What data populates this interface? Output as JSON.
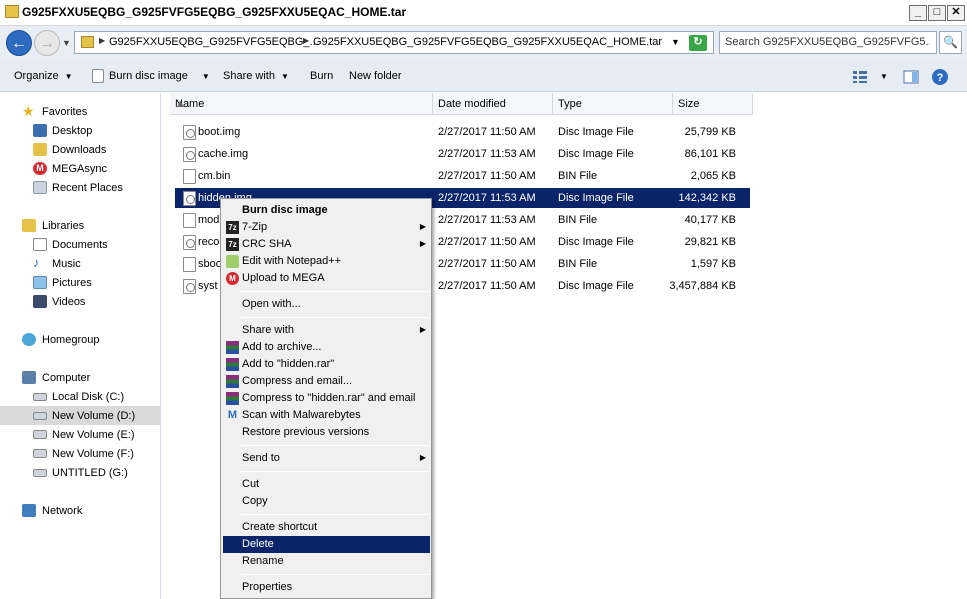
{
  "window": {
    "title": "G925FXXU5EQBG_G925FVFG5EQBG_G925FXXU5EQAC_HOME.tar",
    "min_label": "_",
    "max_label": "□",
    "close_label": "✕"
  },
  "address": {
    "crumb1": "G925FXXU5EQBG_G925FVFG5EQBG_...",
    "crumb2": "G925FXXU5EQBG_G925FVFG5EQBG_G925FXXU5EQAC_HOME.tar",
    "search_placeholder": "Search G925FXXU5EQBG_G925FVFG5..."
  },
  "toolbar": {
    "organize": "Organize",
    "burn_disc_image": "Burn disc image",
    "share_with": "Share with",
    "burn": "Burn",
    "new_folder": "New folder"
  },
  "sidebar": {
    "favorites": "Favorites",
    "desktop": "Desktop",
    "downloads": "Downloads",
    "megasync": "MEGAsync",
    "recent_places": "Recent Places",
    "libraries": "Libraries",
    "documents": "Documents",
    "music": "Music",
    "pictures": "Pictures",
    "videos": "Videos",
    "homegroup": "Homegroup",
    "computer": "Computer",
    "local_disk_c": "Local Disk (C:)",
    "new_volume_d": "New Volume (D:)",
    "new_volume_e": "New Volume (E:)",
    "new_volume_f": "New Volume (F:)",
    "untitled_g": "UNTITLED (G:)",
    "network": "Network"
  },
  "columns": {
    "name": "Name",
    "date_modified": "Date modified",
    "type": "Type",
    "size": "Size"
  },
  "files": [
    {
      "name": "boot.img",
      "date": "2/27/2017 11:50 AM",
      "type": "Disc Image File",
      "size": "25,799 KB"
    },
    {
      "name": "cache.img",
      "date": "2/27/2017 11:53 AM",
      "type": "Disc Image File",
      "size": "86,101 KB"
    },
    {
      "name": "cm.bin",
      "date": "2/27/2017 11:50 AM",
      "type": "BIN File",
      "size": "2,065 KB"
    },
    {
      "name": "hidden.img",
      "date": "2/27/2017 11:53 AM",
      "type": "Disc Image File",
      "size": "142,342 KB"
    },
    {
      "name": "mod",
      "date": "2/27/2017 11:53 AM",
      "type": "BIN File",
      "size": "40,177 KB"
    },
    {
      "name": "reco",
      "date": "2/27/2017 11:50 AM",
      "type": "Disc Image File",
      "size": "29,821 KB"
    },
    {
      "name": "sboo",
      "date": "2/27/2017 11:50 AM",
      "type": "BIN File",
      "size": "1,597 KB"
    },
    {
      "name": "syst",
      "date": "2/27/2017 11:50 AM",
      "type": "Disc Image File",
      "size": "3,457,884 KB"
    }
  ],
  "context_menu": {
    "burn_disc_image": "Burn disc image",
    "seven_zip": "7-Zip",
    "crc_sha": "CRC SHA",
    "edit_notepad": "Edit with Notepad++",
    "upload_mega": "Upload to MEGA",
    "open_with": "Open with...",
    "share_with": "Share with",
    "add_to_archive": "Add to archive...",
    "add_to_rar": "Add to \"hidden.rar\"",
    "compress_email": "Compress and email...",
    "compress_rar_email": "Compress to \"hidden.rar\" and email",
    "scan_malwarebytes": "Scan with Malwarebytes",
    "restore_versions": "Restore previous versions",
    "send_to": "Send to",
    "cut": "Cut",
    "copy": "Copy",
    "create_shortcut": "Create shortcut",
    "delete": "Delete",
    "rename": "Rename",
    "properties": "Properties"
  },
  "icons": {
    "seven_zip": "7z",
    "mega": "M",
    "malwarebytes": "M"
  },
  "colors": {
    "selection": "#0a246a",
    "toolbar_bg": "#e6ecf4",
    "menu_bg": "#f0f0f0"
  }
}
